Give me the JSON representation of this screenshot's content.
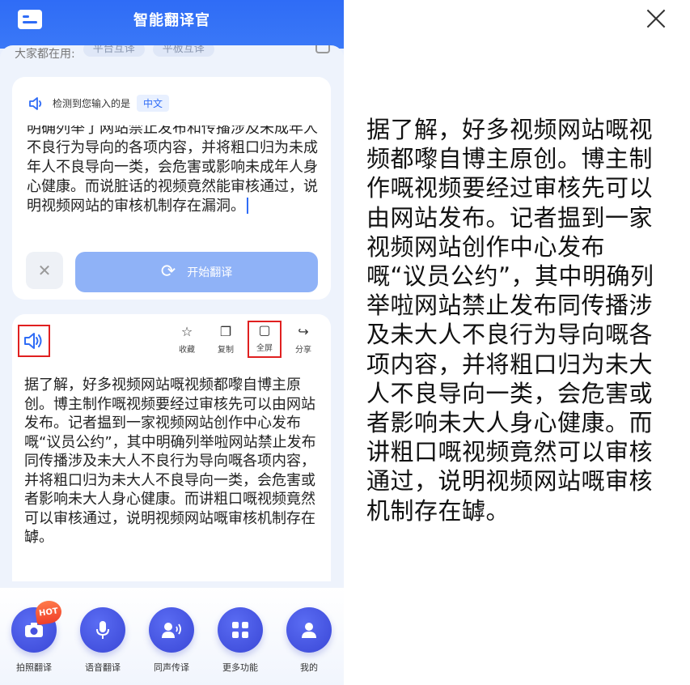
{
  "app": {
    "title": "智能翻译官"
  },
  "common": {
    "label": "大家都在用:",
    "chips": [
      "平台互译",
      "平板互译"
    ]
  },
  "input_card": {
    "detect_label": "检测到您输入的是",
    "detected_lang": "中文",
    "text": "明确列举了网站禁止发布和传播涉及未成年人不良行为导向的各项内容，并将粗口归为未成年人不良导向一类，会危害或影响未成年人身心健康。而说脏话的视频竟然能审核通过，说明视频网站的审核机制存在漏洞。",
    "clear_icon": "close-icon",
    "translate_label": "开始翻译"
  },
  "result_card": {
    "actions": [
      {
        "label": "收藏",
        "icon": "star-icon"
      },
      {
        "label": "复制",
        "icon": "copy-icon"
      },
      {
        "label": "全屏",
        "icon": "fullscreen-icon"
      },
      {
        "label": "分享",
        "icon": "share-icon"
      }
    ],
    "text": "据了解，好多视频网站嘅视频都嚟自博主原创。博主制作嘅视频要经过审核先可以由网站发布。记者揾到一家视频网站创作中心发布嘅“议员公约”，其中明确列举啦网站禁止发布同传播涉及未大人不良行为导向嘅各项内容，并将粗口归为未大人不良导向一类，会危害或者影响未大人身心健康。而讲粗口嘅视频竟然可以审核通过，说明视频网站嘅审核机制存在罅。"
  },
  "bottom_nav": {
    "hot_badge": "HOT",
    "items": [
      {
        "label": "拍照翻译",
        "icon": "camera-icon"
      },
      {
        "label": "语音翻译",
        "icon": "microphone-icon"
      },
      {
        "label": "同声传译",
        "icon": "interpreter-icon"
      },
      {
        "label": "更多功能",
        "icon": "grid-icon"
      },
      {
        "label": "我的",
        "icon": "user-icon"
      }
    ]
  },
  "fullscreen": {
    "text": "据了解，好多视频网站嘅视频都嚟自博主原创。博主制作嘅视频要经过审核先可以由网站发布。记者揾到一家视频网站创作中心发布嘅“议员公约”，其中明确列举啦网站禁止发布同传播涉及未大人不良行为导向嘅各项内容，并将粗口归为未大人不良导向一类，会危害或者影响未大人身心健康。而讲粗口嘅视频竟然可以审核通过，说明视频网站嘅审核机制存在罅。",
    "close_icon": "close-icon"
  },
  "colors": {
    "accent": "#2f6cf6",
    "highlight_box": "#e02020",
    "button_disabled": "#8fb2f7"
  }
}
